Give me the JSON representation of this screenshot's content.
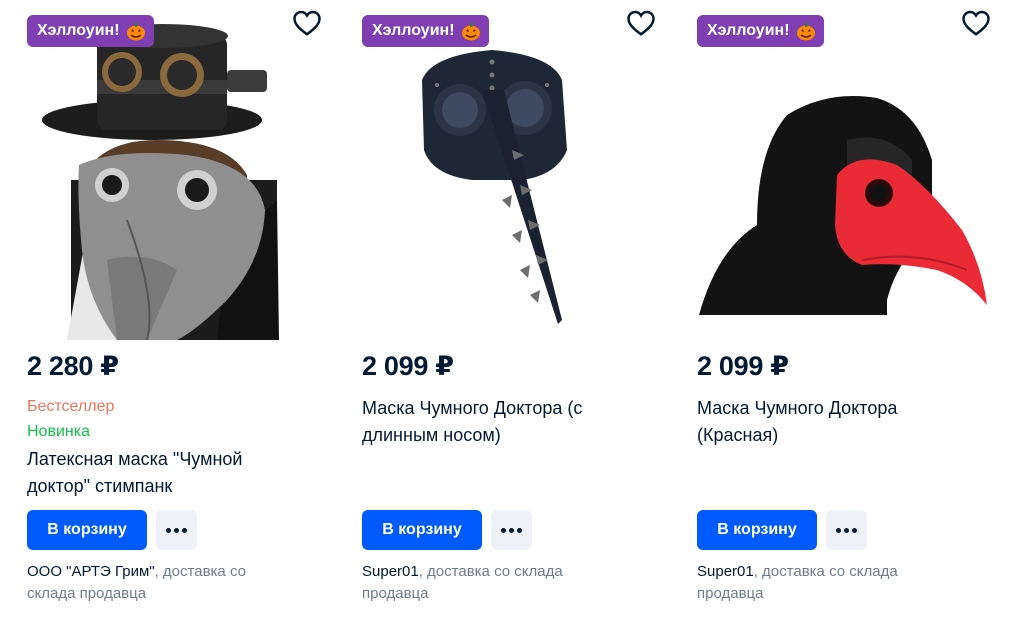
{
  "products": [
    {
      "promo": "Хэллоуин!",
      "price": "2 280 ₽",
      "badge_bestseller": "Бестселлер",
      "badge_new": "Новинка",
      "title": "Латексная маска \"Чумной доктор\" стимпанк",
      "cart_label": "В корзину",
      "seller_name": "ООО \"АРТЭ Грим\"",
      "seller_note": ", доставка со склада продавца"
    },
    {
      "promo": "Хэллоуин!",
      "price": "2 099 ₽",
      "title": "Маска Чумного Доктора (с длинным носом)",
      "cart_label": "В корзину",
      "seller_name": "Super01",
      "seller_note": ", доставка со склада продавца"
    },
    {
      "promo": "Хэллоуин!",
      "price": "2 099 ₽",
      "title": "Маска Чумного Доктора (Красная)",
      "cart_label": "В корзину",
      "seller_name": "Super01",
      "seller_note": ", доставка со склада продавца"
    }
  ],
  "colors": {
    "promo_bg": "#7f3fb3",
    "cart_button": "#005bff",
    "bestseller": "#f1735a",
    "new": "#10c44c",
    "price": "#001a34"
  },
  "icons": {
    "favorite": "heart-outline-icon",
    "promo": "pumpkin-icon",
    "more": "more-dots-icon"
  }
}
